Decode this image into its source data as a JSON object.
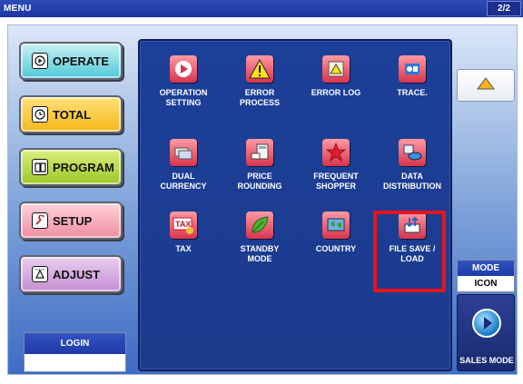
{
  "titlebar": {
    "title": "MENU",
    "page": "2/2"
  },
  "left_menu": {
    "operate": {
      "label": "OPERATE",
      "icon": "play-icon"
    },
    "total": {
      "label": "TOTAL",
      "icon": "clock-icon"
    },
    "program": {
      "label": "PROGRAM",
      "icon": "book-icon"
    },
    "setup": {
      "label": "SETUP",
      "icon": "wrench-icon"
    },
    "adjust": {
      "label": "ADJUST",
      "icon": "adjust-icon"
    }
  },
  "login": {
    "label": "LOGIN",
    "value": ""
  },
  "tiles": [
    {
      "label": "OPERATION\nSETTING",
      "icon": "operation-setting-icon"
    },
    {
      "label": "ERROR\nPROCESS",
      "icon": "warning-icon"
    },
    {
      "label": "ERROR LOG",
      "icon": "error-log-icon"
    },
    {
      "label": "TRACE.",
      "icon": "trace-icon"
    },
    {
      "label": "DUAL\nCURRENCY",
      "icon": "currency-icon"
    },
    {
      "label": "PRICE\nROUNDING",
      "icon": "calculator-icon"
    },
    {
      "label": "FREQUENT\nSHOPPER",
      "icon": "star-icon"
    },
    {
      "label": "DATA\nDISTRIBUTION",
      "icon": "data-distribution-icon"
    },
    {
      "label": "TAX",
      "icon": "tax-icon"
    },
    {
      "label": "STANDBY\nMODE",
      "icon": "leaf-icon"
    },
    {
      "label": "COUNTRY",
      "icon": "country-map-icon"
    },
    {
      "label": "FILE SAVE /\nLOAD",
      "icon": "file-save-load-icon"
    }
  ],
  "right": {
    "up_icon": "triangle-up-icon",
    "mode": {
      "label": "MODE",
      "value": "ICON"
    },
    "sales_mode": {
      "label": "SALES MODE"
    }
  },
  "colors": {
    "highlight": "#e8131e",
    "panel": "#1c3f99",
    "titlebar": "#2e4cb8"
  }
}
